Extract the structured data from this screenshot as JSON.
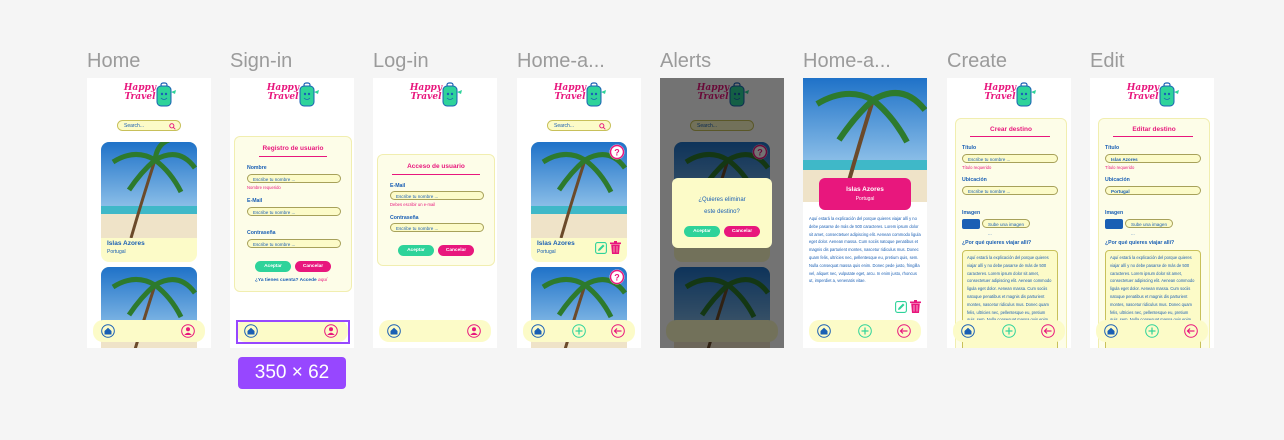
{
  "frames": {
    "home": "Home",
    "signin": "Sign-in",
    "login": "Log-in",
    "home_admin": "Home-a...",
    "alerts": "Alerts",
    "home_admin_detail": "Home-a...",
    "create": "Create",
    "edit": "Edit"
  },
  "logo": {
    "line1": "Happy",
    "line2": "Travel"
  },
  "search": {
    "placeholder": "Search..."
  },
  "destination": {
    "name": "Islas Azores",
    "country": "Portugal"
  },
  "signin": {
    "title": "Registro de usuario",
    "name_label": "Nombre",
    "email_label": "E-Mail",
    "password_label": "Contraseña",
    "input_placeholder": "Escribe tu nombre ...",
    "name_required": "Nombre requerido",
    "accept": "Aceptar",
    "cancel": "Cancelar",
    "has_account": "¿Ya tienes cuenta? Accede",
    "here": "aquí"
  },
  "login": {
    "title": "Acceso de usuario",
    "email_label": "E-Mail",
    "password_label": "Contraseña",
    "input_placeholder": "Escribe tu nombre ...",
    "email_required": "Debes escribir un e-mail",
    "accept": "Aceptar",
    "cancel": "Cancelar"
  },
  "alert": {
    "question_line1": "¿Quieres eliminar",
    "question_line2": "este destino?",
    "accept": "Aceptar",
    "cancel": "Cancelar"
  },
  "detail": {
    "text": "Aquí estará la explicación del porque quieres viajar allí y no debe pasarse de más de 500 caracteres. Lorem ipsum dolor sit amet, consectetuer adipiscing elit. Aenean commodo ligula eget dolor. Aenean massa. Cum sociis natoque penatibus et magnis dis parturient montes, nascetur ridiculus mus. Donec quam felis, ultricies nec, pellentesque eu, pretium quis, sem. Nulla consequat massa quis enim. Donec pede justo, fringilla vel, aliquet nec, vulputate eget, arcu. In enim justo, rhoncus ut, imperdiet a, venenatis vitae."
  },
  "create": {
    "title": "Crear destino",
    "title_label": "Título",
    "title_placeholder": "Escribe tu nombre ...",
    "title_required": "Título requerido",
    "location_label": "Ubicación",
    "location_placeholder": "Escribe tu nombre ...",
    "image_label": "Imagen",
    "image_upload": "Sube una imagen ...",
    "why_label": "¿Por qué quieres viajar allí?",
    "why_text": "Aquí estará la explicación del porque quieres viajar allí y no debe pasarse de más de 500 caracteres. Lorem ipsum dolor sit amet, consectetuer adipiscing elit. Aenean commodo ligula eget dolor. Aenean massa. Cum sociis natoque penatibus et magnis dis parturient montes, nascetur ridiculus mus. Donec quam felis, ultricies nec, pellentesque eu, pretium quis, sem. Nulla consequat massa quis enim. Donec pede justo, fringilla vel, aliquet nec, vulputate"
  },
  "edit": {
    "title": "Editar destino",
    "title_label": "Título",
    "title_value": "Islas Azores",
    "title_required": "Título requerido",
    "location_label": "Ubicación",
    "location_value": "Portugal",
    "image_label": "Imagen",
    "image_upload": "Sube una imagen ...",
    "why_label": "¿Por qué quieres viajar allí?",
    "why_text": "Aquí estará la explicación del porque quieres viajar allí y no debe pasarse de más de 500 caracteres. Lorem ipsum dolor sit amet, consectetuer adipiscing elit. Aenean commodo ligula eget dolor. Aenean massa. Cum sociis natoque penatibus et magnis dis parturient montes, nascetur ridiculus mus. Donec quam felis, ultricies nec, pellentesque eu, pretium quis, sem. Nulla consequat massa quis enim. Donec pede justo, fringilla vel, aliquet nec, vulputate"
  },
  "selection": {
    "dimensions": "350 × 62"
  },
  "colors": {
    "brand_pink": "#e8177d",
    "brand_blue": "#1a5fb4",
    "accent_green": "#2ed39a",
    "surface_yellow": "#fcfbc8",
    "selection_purple": "#9747ff"
  }
}
